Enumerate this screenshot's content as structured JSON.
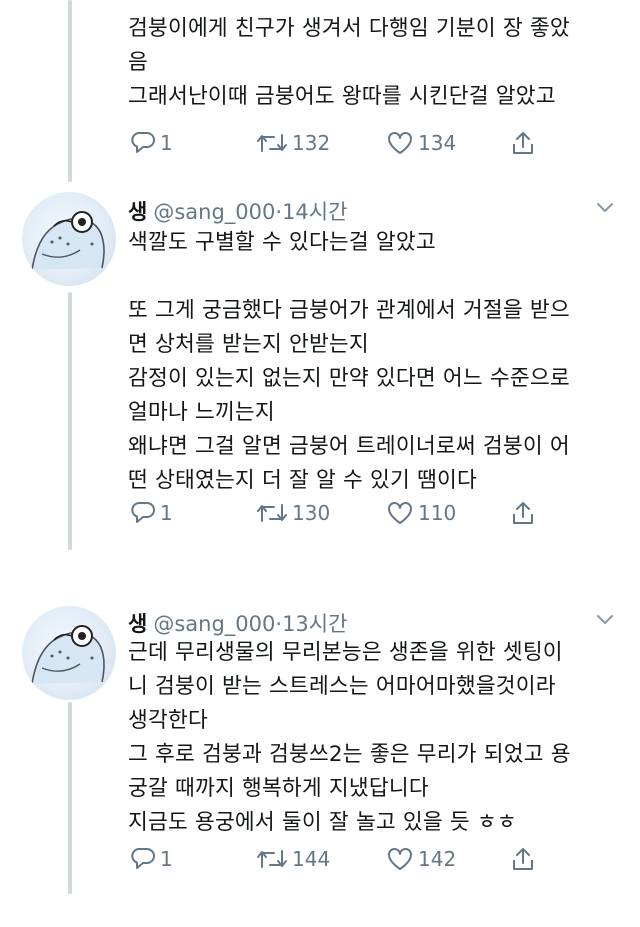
{
  "tweets": [
    {
      "name": "",
      "handle": "",
      "time": "",
      "text": "검붕이에게 친구가 생겨서 다행임 기분이 장 좋았\n음\n그래서난이때 금붕어도 왕따를 시킨단걸 알았고",
      "replies": "1",
      "retweets": "132",
      "likes": "134"
    },
    {
      "name": "생",
      "handle": "@sang_000",
      "time": "14시간",
      "text": "색깔도 구별할 수 있다는걸 알았고\n\n또 그게 궁금했다 금붕어가 관계에서 거절을 받으\n면 상처를 받는지 안받는지\n감정이 있는지 없는지 만약 있다면 어느 수준으로\n얼마나 느끼는지\n왜냐면 그걸 알면 금붕어 트레이너로써 검붕이 어\n떤 상태였는지 더 잘 알 수 있기 땜이다",
      "replies": "1",
      "retweets": "130",
      "likes": "110"
    },
    {
      "name": "생",
      "handle": "@sang_000",
      "time": "13시간",
      "text": "근데 무리생물의 무리본능은 생존을 위한 셋팅이\n니 검붕이 받는 스트레스는 어마어마했을것이라\n생각한다\n그 후로 검붕과 검붕쓰2는 좋은 무리가 되었고 용\n궁갈 때까지 행복하게 지냈답니다\n지금도 용궁에서 둘이 잘 놀고 있을 듯 ㅎㅎ",
      "replies": "1",
      "retweets": "144",
      "likes": "142"
    }
  ],
  "header_separator": "·",
  "colors": {
    "text": "#14171a",
    "muted": "#657786",
    "thread_line": "#cfd9de"
  },
  "icons": [
    "reply-icon",
    "retweet-icon",
    "like-icon",
    "share-icon",
    "chevron-down-icon",
    "avatar-frog"
  ]
}
